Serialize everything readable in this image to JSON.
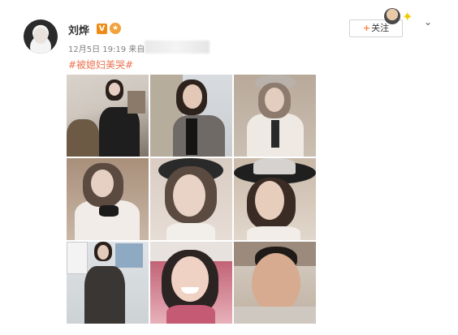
{
  "post": {
    "username": "刘烨",
    "verified_badge": "V",
    "medal_icon": "medal-icon",
    "timestamp": "12月5日 19:19",
    "source_prefix": "来自",
    "topic": "#被媳妇美哭#",
    "follow_label": "关注",
    "follow_plus": "+"
  },
  "colors": {
    "topic": "#eb7350",
    "follow_plus": "#ff8140",
    "verified": "#f08a14"
  },
  "photos": [
    {
      "subject": "woman seated in black dress, plants"
    },
    {
      "subject": "woman in grey blazer"
    },
    {
      "subject": "woman in white blouse, soft focus"
    },
    {
      "subject": "woman in white blouse with bow"
    },
    {
      "subject": "woman in black hat, close-up"
    },
    {
      "subject": "woman in wide-brim hat"
    },
    {
      "subject": "woman in black suit standing"
    },
    {
      "subject": "smiling girl with braids"
    },
    {
      "subject": "man lying down selfie"
    }
  ]
}
